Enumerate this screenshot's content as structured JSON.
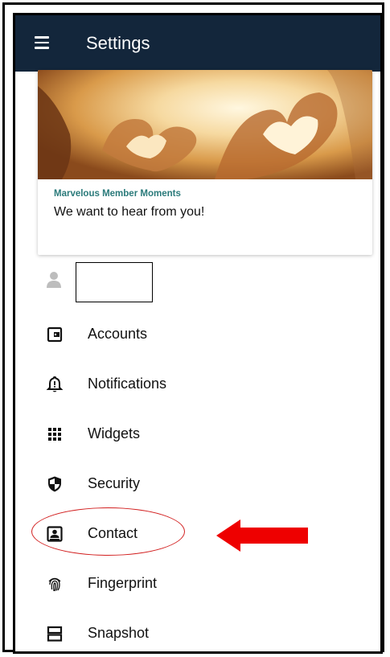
{
  "appbar": {
    "title": "Settings",
    "background": "#13263b",
    "menu_icon": "hamburger-menu-icon"
  },
  "promo_card": {
    "caption": "Marvelous Member Moments",
    "headline": "We want to hear from you!",
    "caption_color": "#2a7a7a"
  },
  "profile": {
    "avatar_icon": "person-icon",
    "name": ""
  },
  "menu": {
    "items": [
      {
        "label": "Accounts",
        "icon": "wallet-icon"
      },
      {
        "label": "Notifications",
        "icon": "bell-alert-icon"
      },
      {
        "label": "Widgets",
        "icon": "grid-dots-icon"
      },
      {
        "label": "Security",
        "icon": "shield-icon"
      },
      {
        "label": "Contact",
        "icon": "contact-card-icon"
      },
      {
        "label": "Fingerprint",
        "icon": "fingerprint-icon"
      },
      {
        "label": "Snapshot",
        "icon": "snapshot-icon"
      }
    ]
  },
  "annotations": {
    "highlight_color": "#d21f1f",
    "arrow_color": "#ee0000"
  }
}
